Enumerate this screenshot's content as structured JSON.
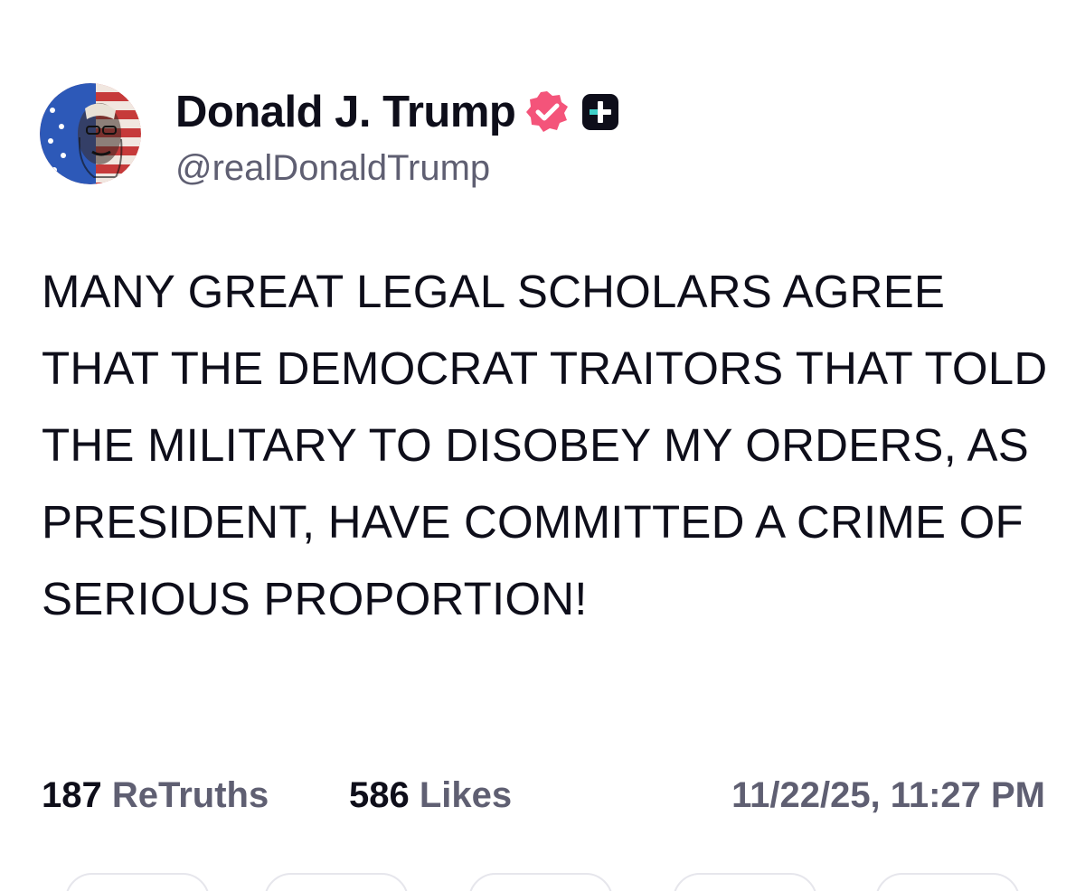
{
  "author": {
    "display_name": "Donald J. Trump",
    "handle": "@realDonaldTrump",
    "avatar_icon": "avatar-flag-portrait",
    "verified_icon": "verified-badge-icon",
    "verified_color": "#f4547a",
    "plus_icon": "plus-badge-icon"
  },
  "post": {
    "text": "MANY GREAT LEGAL SCHOLARS AGREE THAT THE DEMOCRAT TRAITORS THAT TOLD THE MILITARY TO DISOBEY MY ORDERS, AS PRESIDENT, HAVE COMMITTED A CRIME OF SERIOUS PROPORTION!"
  },
  "stats": {
    "retruths_count": "187",
    "retruths_label": "ReTruths",
    "likes_count": "586",
    "likes_label": "Likes",
    "timestamp": "11/22/25, 11:27 PM"
  },
  "colors": {
    "text": "#0e0e1a",
    "muted": "#5f5f72"
  }
}
